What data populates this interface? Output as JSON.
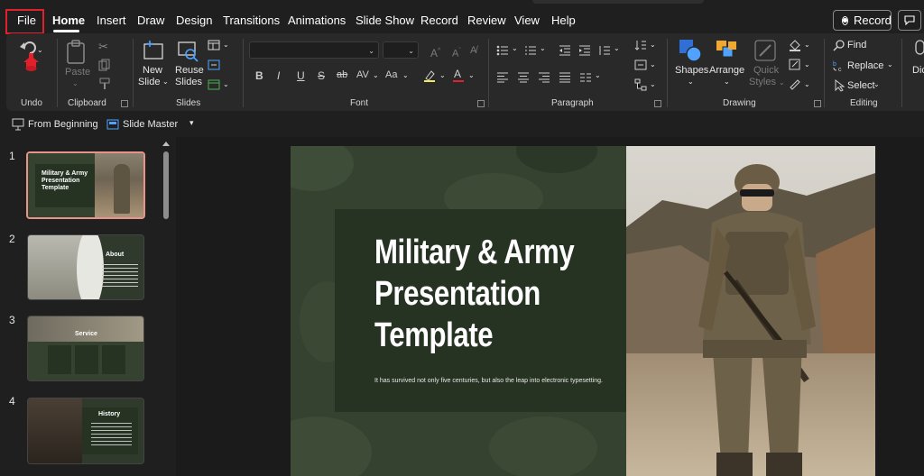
{
  "menu": {
    "tabs": [
      "File",
      "Home",
      "Insert",
      "Draw",
      "Design",
      "Transitions",
      "Animations",
      "Slide Show",
      "Record",
      "Review",
      "View",
      "Help"
    ],
    "record_label": "Record"
  },
  "ribbon": {
    "groups": {
      "undo": "Undo",
      "clipboard": "Clipboard",
      "slides": "Slides",
      "font": "Font",
      "paragraph": "Paragraph",
      "drawing": "Drawing",
      "editing": "Editing"
    },
    "paste": "Paste",
    "new_slide_1": "New",
    "new_slide_2": "Slide",
    "reuse_1": "Reuse",
    "reuse_2": "Slides",
    "shapes": "Shapes",
    "arrange": "Arrange",
    "quick_styles_1": "Quick",
    "quick_styles_2": "Styles",
    "find": "Find",
    "replace": "Replace",
    "select": "Select",
    "dictate_partial": "Dic",
    "font_buttons": [
      "B",
      "I",
      "U",
      "S",
      "ab",
      "AV",
      "Aa"
    ]
  },
  "quick_access": {
    "from_beginning": "From Beginning",
    "slide_master": "Slide Master"
  },
  "thumbnails": [
    {
      "number": "1",
      "title": "Military & Army Presentation Template",
      "selected": true
    },
    {
      "number": "2",
      "title": "About",
      "selected": false
    },
    {
      "number": "3",
      "title": "Service",
      "selected": false
    },
    {
      "number": "4",
      "title": "History",
      "selected": false
    }
  ],
  "slide": {
    "title_lines": [
      "Military & Army",
      "Presentation",
      "Template"
    ],
    "subtitle": "It has survived not only five centuries, but also the leap into electronic typesetting."
  },
  "colors": {
    "accent_red": "#e0202a",
    "slide_green": "#34422f",
    "slide_dark_green": "#263322",
    "thumb_selected": "#e8938a"
  }
}
